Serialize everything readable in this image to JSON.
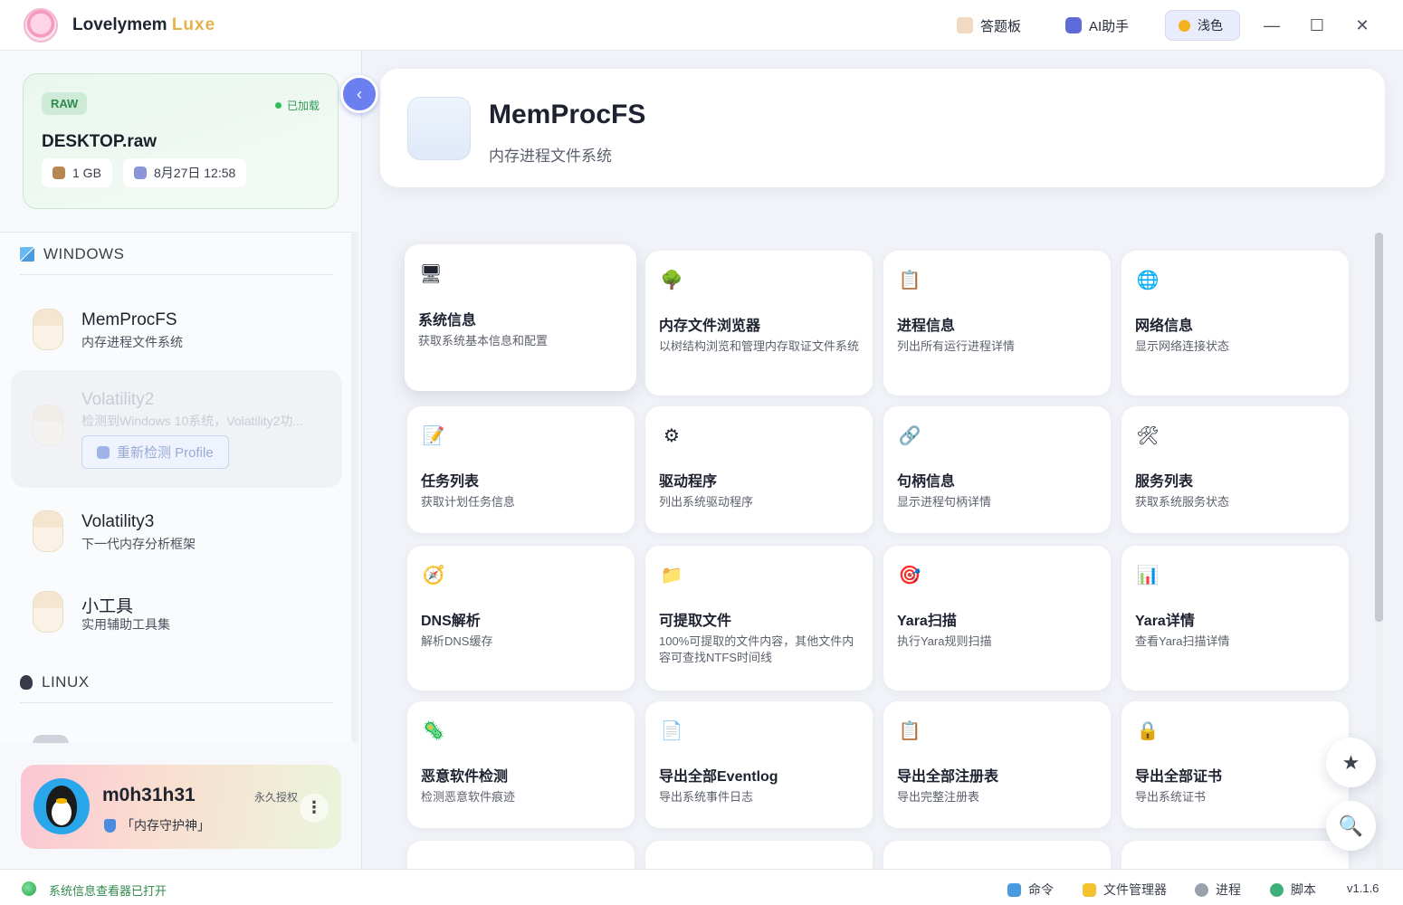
{
  "app": {
    "title_main": "Lovelymem",
    "title_accent": "Luxe",
    "toolbar": {
      "answer_board": "答题板",
      "ai_assistant": "AI助手",
      "theme": "浅色"
    },
    "window": {
      "minimize": "—",
      "maximize": "☐",
      "close": "✕"
    }
  },
  "file": {
    "type": "RAW",
    "status": "已加载",
    "name": "DESKTOP.raw",
    "size": "1 GB",
    "date": "8月27日 12:58"
  },
  "sidebar": {
    "collapse_icon": "‹",
    "windows_label": "WINDOWS",
    "linux_label": "LINUX",
    "items": [
      {
        "title": "MemProcFS",
        "sub": "内存进程文件系统"
      },
      {
        "title": "Volatility2",
        "sub": "检测到Windows 10系统，Volatility2功...",
        "button": "重新检测 Profile"
      },
      {
        "title": "Volatility3",
        "sub": "下一代内存分析框架"
      },
      {
        "title": "小工具",
        "sub": "实用辅助工具集"
      }
    ]
  },
  "user": {
    "name": "m0h31h31",
    "title": "「内存守护神」",
    "license": "永久授权",
    "more": "⋮"
  },
  "header": {
    "title": "MemProcFS",
    "subtitle": "内存进程文件系统"
  },
  "cards": [
    {
      "icon": "🖥",
      "title": "系统信息",
      "desc": "获取系统基本信息和配置"
    },
    {
      "icon": "🌳",
      "title": "内存文件浏览器",
      "desc": "以树结构浏览和管理内存取证文件系统"
    },
    {
      "icon": "📋",
      "title": "进程信息",
      "desc": "列出所有运行进程详情"
    },
    {
      "icon": "🌐",
      "title": "网络信息",
      "desc": "显示网络连接状态"
    },
    {
      "icon": "📝",
      "title": "任务列表",
      "desc": "获取计划任务信息"
    },
    {
      "icon": "⚙",
      "title": "驱动程序",
      "desc": "列出系统驱动程序"
    },
    {
      "icon": "🔗",
      "title": "句柄信息",
      "desc": "显示进程句柄详情"
    },
    {
      "icon": "🛠",
      "title": "服务列表",
      "desc": "获取系统服务状态"
    },
    {
      "icon": "🧭",
      "title": "DNS解析",
      "desc": "解析DNS缓存"
    },
    {
      "icon": "📁",
      "title": "可提取文件",
      "desc": "100%可提取的文件内容，其他文件内容可查找NTFS时间线"
    },
    {
      "icon": "🎯",
      "title": "Yara扫描",
      "desc": "执行Yara规则扫描"
    },
    {
      "icon": "📊",
      "title": "Yara详情",
      "desc": "查看Yara扫描详情"
    },
    {
      "icon": "🦠",
      "title": "恶意软件检测",
      "desc": "检测恶意软件痕迹"
    },
    {
      "icon": "📄",
      "title": "导出全部Eventlog",
      "desc": "导出系统事件日志"
    },
    {
      "icon": "📋",
      "title": "导出全部注册表",
      "desc": "导出完整注册表"
    },
    {
      "icon": "🔒",
      "title": "导出全部证书",
      "desc": "导出系统证书"
    }
  ],
  "fab": {
    "star": "★",
    "search": "🔍"
  },
  "status": {
    "message": "系统信息查看器已打开",
    "command": "命令",
    "file_manager": "文件管理器",
    "process": "进程",
    "script": "脚本",
    "version": "v1.1.6"
  },
  "colors": {
    "accent": "#6b7ff0",
    "success": "#2f9a52"
  }
}
